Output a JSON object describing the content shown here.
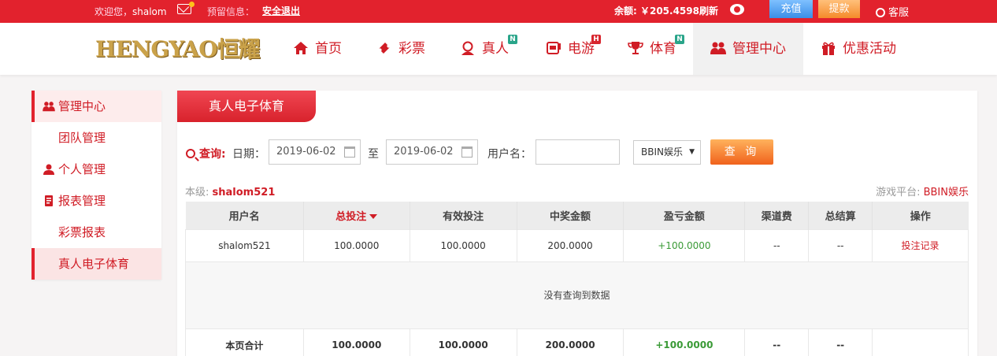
{
  "topbar": {
    "welcome": "欢迎您，",
    "username": "shalom",
    "warning": "预留信息：",
    "logout": "安全退出",
    "balance": "余额: ￥205.4598",
    "refresh": "刷新",
    "charge": "充值",
    "withdraw": "提款",
    "service": "客服"
  },
  "nav": {
    "logo": "HENGYAO恒耀",
    "items": [
      {
        "label": "首页",
        "icon": "home-icon"
      },
      {
        "label": "彩票",
        "icon": "ticket-icon"
      },
      {
        "label": "真人",
        "icon": "live-dealer-icon",
        "badge": "N"
      },
      {
        "label": "电游",
        "icon": "slot-machine-icon",
        "badge": "H"
      },
      {
        "label": "体育",
        "icon": "trophy-icon",
        "badge": "N"
      },
      {
        "label": "管理中心",
        "icon": "users-icon"
      },
      {
        "label": "优惠活动",
        "icon": "gift-icon"
      }
    ]
  },
  "sidebar": {
    "items": [
      {
        "label": "管理中心"
      },
      {
        "label": "团队管理"
      },
      {
        "label": "个人管理"
      },
      {
        "label": "报表管理"
      },
      {
        "label": "彩票报表"
      },
      {
        "label": "真人电子体育"
      }
    ]
  },
  "panel": {
    "tab": "真人电子体育",
    "query_label": "查询:",
    "date_label": "日期：",
    "date_from": "2019-06-02",
    "to_label": "至",
    "date_to": "2019-06-02",
    "username_label": "用户名：",
    "username_value": "",
    "platform_select": "BBIN娱乐",
    "search_button": "查 询",
    "level_label": "本级:",
    "level_user": "shalom521",
    "platform_label": "游戏平台:",
    "platform_value": "BBIN娱乐"
  },
  "table": {
    "headers": [
      "用户名",
      "总投注",
      "有效投注",
      "中奖金额",
      "盈亏金额",
      "渠道费",
      "总结算",
      "操作"
    ],
    "row": {
      "username": "shalom521",
      "total_bet": "100.0000",
      "valid_bet": "100.0000",
      "win_amount": "200.0000",
      "profit": "+100.0000",
      "channel_fee": "--",
      "settlement": "--",
      "action": "投注记录"
    },
    "empty_message": "没有查询到数据",
    "total": {
      "label": "本页合计",
      "total_bet": "100.0000",
      "valid_bet": "100.0000",
      "win_amount": "200.0000",
      "profit": "+100.0000",
      "channel_fee": "--",
      "settlement": "--"
    }
  },
  "colors": {
    "brand_red": "#e2222d",
    "text_red": "#d01c25",
    "profit_green": "#3a9a36",
    "charge_blue": "#3b8ee8",
    "withdraw_orange": "#f58a2a"
  }
}
